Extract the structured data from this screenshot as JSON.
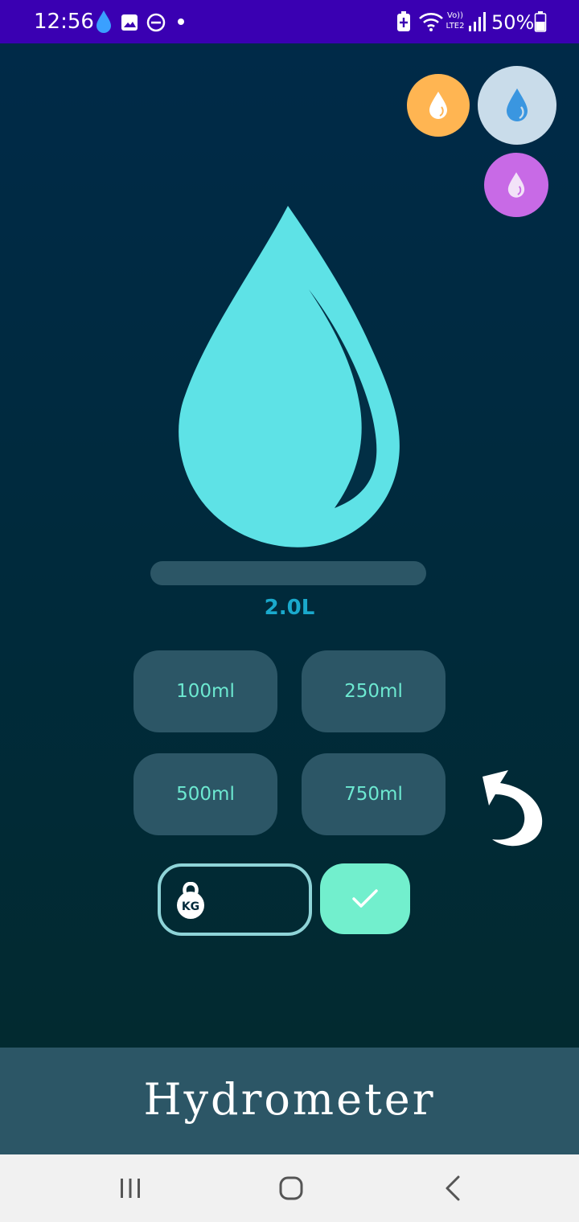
{
  "status_bar": {
    "time": "12:56",
    "battery_percent": "50%",
    "network_label": "Vo)) LTE2",
    "icons": [
      "water-drop-icon",
      "image-icon",
      "do-not-disturb-icon",
      "dot-icon",
      "battery-saver-icon",
      "wifi-icon",
      "signal-icon",
      "battery-icon"
    ],
    "background": "#3a00b2"
  },
  "theme_selector": {
    "options": [
      {
        "name": "orange",
        "color": "#ffb552",
        "icon": "water-drop-icon"
      },
      {
        "name": "blue",
        "color": "#c9dcea",
        "icon": "water-drop-icon",
        "selected": true
      },
      {
        "name": "purple",
        "color": "#c86ae6",
        "icon": "water-drop-icon"
      }
    ]
  },
  "hydration": {
    "drop_icon": "water-drop-icon",
    "drop_color": "#5ee2e6",
    "progress_fraction": 0,
    "intake_label": "2.0L"
  },
  "amount_buttons": {
    "b100": "100ml",
    "b250": "250ml",
    "b500": "500ml",
    "b750": "750ml"
  },
  "controls": {
    "undo_icon": "undo-icon",
    "weight_icon": "kettlebell-kg-icon",
    "weight_icon_text": "KG",
    "weight_value": "",
    "confirm_icon": "checkmark-icon"
  },
  "footer": {
    "app_name": "Hydrometer"
  },
  "nav_bar": {
    "buttons": [
      "recent-apps-icon",
      "home-icon",
      "back-icon"
    ]
  },
  "colors": {
    "accent": "#5ee2e6",
    "button_bg": "#2c5666",
    "button_text": "#6de9d1",
    "confirm": "#72efcd"
  }
}
